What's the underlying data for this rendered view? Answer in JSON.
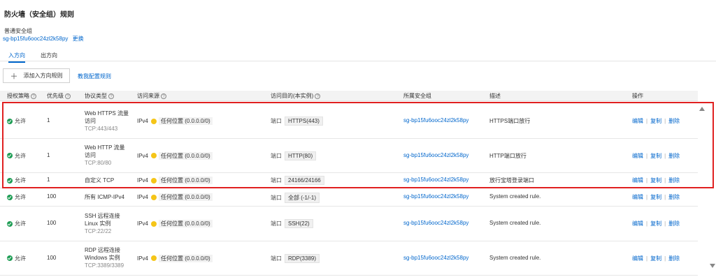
{
  "page": {
    "title": "防火墙（安全组）规则",
    "sg_label": "普通安全组",
    "sg_id": "sg-bp15fu6ooc24zl2k58py",
    "change_label": "更换"
  },
  "tabs": [
    {
      "label": "入方向",
      "active": true
    },
    {
      "label": "出方向",
      "active": false
    }
  ],
  "toolbar": {
    "add_label": "添加入方向规则",
    "tutorial_label": "教我配置规则"
  },
  "table": {
    "headers": [
      "授权策略",
      "优先级",
      "协议类型",
      "访问来源",
      "访问目的(本实例)",
      "所属安全组",
      "描述",
      "操作"
    ],
    "ops": {
      "edit": "编辑",
      "copy": "复制",
      "delete": "删除"
    },
    "rows": [
      {
        "policy": "允许",
        "priority": "1",
        "proto_line1": "Web HTTPS 流量",
        "proto_line2": "访问",
        "proto_sub": "TCP:443/443",
        "src_type": "IPv4",
        "src_value": "任何位置 (0.0.0.0/0)",
        "port_label": "端口",
        "port_value": "HTTPS(443)",
        "sg": "sg-bp15fu6ooc24zl2k58py",
        "desc": "HTTPS端口放行"
      },
      {
        "policy": "允许",
        "priority": "1",
        "proto_line1": "Web HTTP 流量",
        "proto_line2": "访问",
        "proto_sub": "TCP:80/80",
        "src_type": "IPv4",
        "src_value": "任何位置 (0.0.0.0/0)",
        "port_label": "端口",
        "port_value": "HTTP(80)",
        "sg": "sg-bp15fu6ooc24zl2k58py",
        "desc": "HTTP端口放行"
      },
      {
        "policy": "允许",
        "priority": "1",
        "proto_line1": "自定义 TCP",
        "proto_line2": "",
        "proto_sub": "",
        "src_type": "IPv4",
        "src_value": "任何位置 (0.0.0.0/0)",
        "port_label": "端口",
        "port_value": "24166/24166",
        "sg": "sg-bp15fu6ooc24zl2k58py",
        "desc": "放行宝塔登录端口"
      },
      {
        "policy": "允许",
        "priority": "100",
        "proto_line1": "所有 ICMP-IPv4",
        "proto_line2": "",
        "proto_sub": "",
        "src_type": "IPv4",
        "src_value": "任何位置 (0.0.0.0/0)",
        "port_label": "端口",
        "port_value": "全部 (-1/-1)",
        "sg": "sg-bp15fu6ooc24zl2k58py",
        "desc": "System created rule."
      },
      {
        "policy": "允许",
        "priority": "100",
        "proto_line1": "SSH 远程连接",
        "proto_line2": "Linux 实例",
        "proto_sub": "TCP:22/22",
        "src_type": "IPv4",
        "src_value": "任何位置 (0.0.0.0/0)",
        "port_label": "端口",
        "port_value": "SSH(22)",
        "sg": "sg-bp15fu6ooc24zl2k58py",
        "desc": "System created rule."
      },
      {
        "policy": "允许",
        "priority": "100",
        "proto_line1": "RDP 远程连接",
        "proto_line2": "Windows 实例",
        "proto_sub": "TCP:3389/3389",
        "src_type": "IPv4",
        "src_value": "任何位置 (0.0.0.0/0)",
        "port_label": "端口",
        "port_value": "RDP(3389)",
        "sg": "sg-bp15fu6ooc24zl2k58py",
        "desc": "System created rule."
      }
    ]
  },
  "colors": {
    "accent": "#0066cc",
    "allow": "#1f9d55",
    "source_dot": "#f5c518",
    "highlight": "#e02020"
  }
}
